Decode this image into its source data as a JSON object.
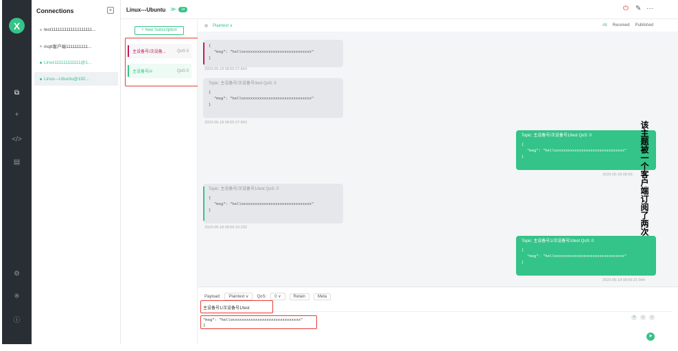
{
  "app": {
    "logo": "X"
  },
  "nav": {
    "icons": [
      "connections-icon",
      "add-icon",
      "script-icon",
      "log-icon",
      "settings-icon",
      "about-icon",
      "info-icon"
    ]
  },
  "connections": {
    "header": "Connections",
    "add": "+",
    "items": [
      {
        "label": "test1111111111111111111..."
      },
      {
        "label": "mqtt客户端1111111111..."
      },
      {
        "label": "Linux111111111111@1..."
      },
      {
        "label": "Linux---Ubuntu@192..."
      }
    ]
  },
  "topbar": {
    "title": "Linux---Ubuntu",
    "badge": "1d",
    "chevron": "≫",
    "power": "⏻",
    "edit": "✎",
    "more": "···"
  },
  "subscriptions": {
    "new_label": "+ New Subscription",
    "items": [
      {
        "topic": "主设备号/次设备...",
        "qos": "QoS 0",
        "color": "#c2185b"
      },
      {
        "topic": "主设备号/#",
        "qos": "QoS 0",
        "color": "#34c388"
      }
    ]
  },
  "messages": {
    "format": "Plaintext ∨",
    "filters": [
      "All",
      "Received",
      "Published"
    ],
    "list": [
      {
        "topic": "",
        "body1": "{",
        "body2": "\"msg\": \"helloxxxxxxxxxxxxxxxxxxxxxxxxxxxxxx\"",
        "body3": "}",
        "time": "2023-05-18 08:55:27:643"
      },
      {
        "topic": "Topic: 主设备号/次设备号/test   QoS: 0",
        "body1": "{",
        "body2": "\"msg\": \"helloxxxxxxxxxxxxxxxxxxxxxxxxxxxxxx\"",
        "body3": "}",
        "time": "2023-05-18 08:55:27:643"
      },
      {
        "topic": "Topic: 主设备号/次设备号1/test   QoS: 0",
        "body1": "{",
        "body2": "\"msg\": \"helloxxxxxxxxxxxxxxxxxxxxxxxxxxxxxx\"",
        "body3": "}",
        "time": "2023-05-18 08:56:"
      },
      {
        "topic": "Topic: 主设备号/次设备号1/test   QoS: 0",
        "body1": "{",
        "body2": "\"msg\": \"helloxxxxxxxxxxxxxxxxxxxxxxxxxxxxxx\"",
        "body3": "}",
        "time": "2023-05-18 08:56:16:232"
      },
      {
        "topic": "Topic: 主设备号1/次设备号1/test   QoS: 0",
        "body1": "{",
        "body2": "\"msg\": \"helloxxxxxxxxxxxxxxxxxxxxxxxxxxxxxx\"",
        "body3": "}",
        "time": "2023-05-18 08:56:21:044"
      }
    ]
  },
  "overlay": {
    "vertical_text": "该主题被一个客户端订阅了两次"
  },
  "composer": {
    "payload_label": "Payload:",
    "payload_format": "Plaintext ∨",
    "qos_label": "QoS:",
    "qos_value": "0 ∨",
    "retain": "Retain",
    "meta": "Meta",
    "topic": "主设备号1/次设备号1/test",
    "payload_line1": "\"msg\": \"helloxxxxxxxxxxxxxxxxxxxxxxxxxxxxxx\"",
    "payload_line2": "}"
  }
}
